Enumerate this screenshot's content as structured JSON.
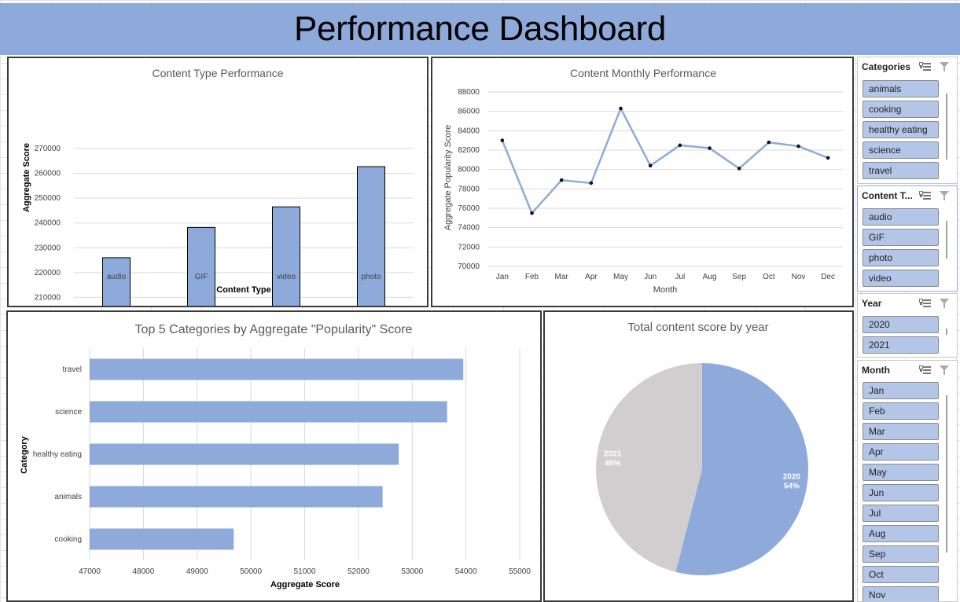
{
  "dashboard": {
    "title": "Performance Dashboard"
  },
  "slicers": [
    {
      "title": "Categories",
      "items": [
        "animals",
        "cooking",
        "healthy eating",
        "science",
        "travel"
      ]
    },
    {
      "title": "Content T...",
      "items": [
        "audio",
        "GIF",
        "photo",
        "video"
      ]
    },
    {
      "title": "Year",
      "items": [
        "2020",
        "2021"
      ]
    },
    {
      "title": "Month",
      "items": [
        "Jan",
        "Feb",
        "Mar",
        "Apr",
        "May",
        "Jun",
        "Jul",
        "Aug",
        "Sep",
        "Oct",
        "Nov"
      ]
    }
  ],
  "chart_data": [
    {
      "type": "bar",
      "title": "Content Type Performance",
      "xlabel": "Content Type",
      "ylabel": "Aggregate Score",
      "categories": [
        "audio",
        "GIF",
        "video",
        "photo"
      ],
      "values": [
        226000,
        238200,
        246500,
        262700
      ],
      "ylim": [
        200000,
        270000
      ],
      "yticks": [
        200000,
        210000,
        220000,
        230000,
        240000,
        250000,
        260000,
        270000
      ],
      "color": "#8eaadb",
      "grid": true,
      "legend": "none"
    },
    {
      "type": "line",
      "title": "Content Monthly Performance",
      "xlabel": "Month",
      "ylabel": "Aggregate Popularity Score",
      "categories": [
        "Jan",
        "Feb",
        "Mar",
        "Apr",
        "May",
        "Jun",
        "Jul",
        "Aug",
        "Sep",
        "Oct",
        "Nov",
        "Dec"
      ],
      "values": [
        83000,
        75500,
        78900,
        78600,
        86300,
        80400,
        82500,
        82200,
        80100,
        82800,
        82400,
        81200
      ],
      "ylim": [
        70000,
        88000
      ],
      "yticks": [
        70000,
        72000,
        74000,
        76000,
        78000,
        80000,
        82000,
        84000,
        86000,
        88000
      ],
      "color": "#8eaadb",
      "grid": true,
      "legend": "none"
    },
    {
      "type": "bar",
      "orientation": "horizontal",
      "title": "Top 5 Categories by Aggregate \"Popularity\" Score",
      "xlabel": "Aggregate Score",
      "ylabel": "Category",
      "categories": [
        "travel",
        "science",
        "healthy eating",
        "animals",
        "cooking"
      ],
      "values": [
        53950,
        53650,
        52750,
        52450,
        49680
      ],
      "xlim": [
        47000,
        55000
      ],
      "xticks": [
        47000,
        48000,
        49000,
        50000,
        51000,
        52000,
        53000,
        54000,
        55000
      ],
      "color": "#8eaadb",
      "grid": true,
      "legend": "none"
    },
    {
      "type": "pie",
      "title": "Total content score by year",
      "slices": [
        {
          "label": "2020",
          "percent": "54%",
          "value": 54,
          "color": "#8eaadb"
        },
        {
          "label": "2021",
          "percent": "46%",
          "value": 46,
          "color": "#d0cece"
        }
      ],
      "legend": "none"
    }
  ]
}
